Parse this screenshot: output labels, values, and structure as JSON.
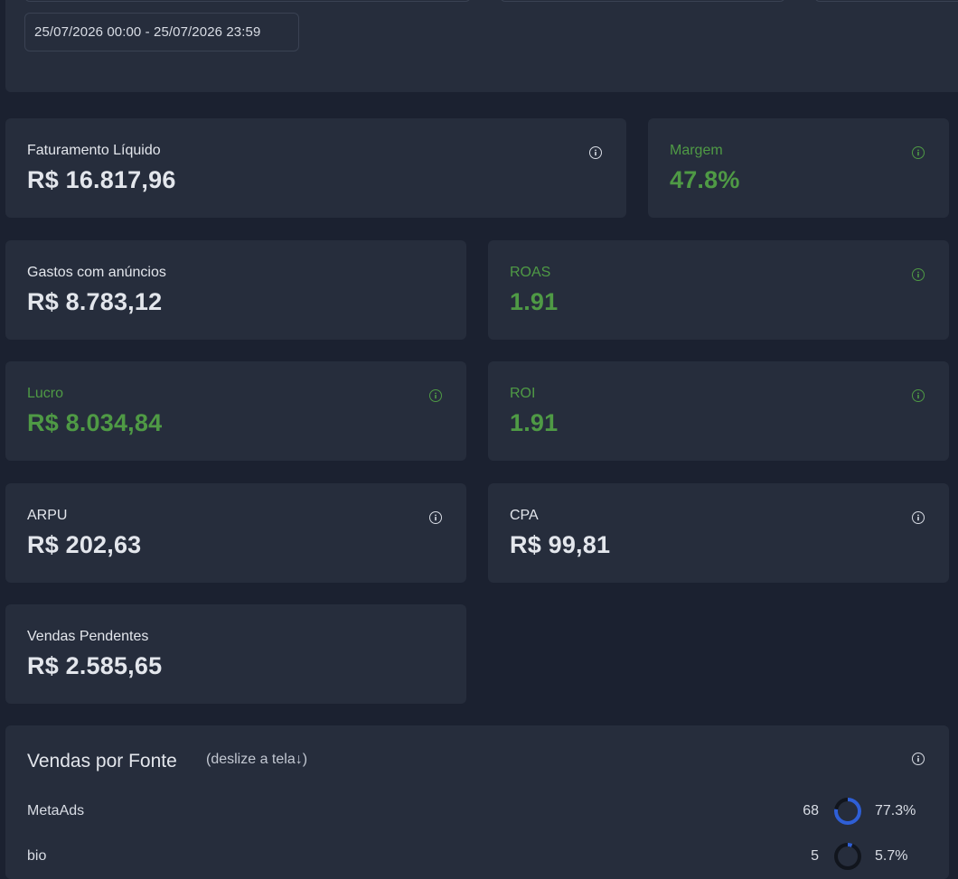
{
  "filter": {
    "date_range": "25/07/2026 00:00 - 25/07/2026 23:59"
  },
  "metrics": {
    "faturamento": {
      "label": "Faturamento Líquido",
      "value": "R$ 16.817,96"
    },
    "margem": {
      "label": "Margem",
      "value": "47.8%"
    },
    "gastos": {
      "label": "Gastos com anúncios",
      "value": "R$ 8.783,12"
    },
    "roas": {
      "label": "ROAS",
      "value": "1.91"
    },
    "lucro": {
      "label": "Lucro",
      "value": "R$ 8.034,84"
    },
    "roi": {
      "label": "ROI",
      "value": "1.91"
    },
    "arpu": {
      "label": "ARPU",
      "value": "R$ 202,63"
    },
    "cpa": {
      "label": "CPA",
      "value": "R$ 99,81"
    },
    "pendentes": {
      "label": "Vendas Pendentes",
      "value": "R$ 2.585,65"
    }
  },
  "vendas_fonte": {
    "title": "Vendas por Fonte",
    "hint": "(deslize a tela↓)",
    "rows": [
      {
        "source": "MetaAds",
        "count": "68",
        "percent": "77.3%",
        "fraction": 0.773
      },
      {
        "source": "bio",
        "count": "5",
        "percent": "5.7%",
        "fraction": 0.057
      }
    ]
  },
  "colors": {
    "positive": "#4f9a45",
    "card": "#262d3c",
    "background": "#1b2130",
    "donut_fill": "#2f5fd6",
    "donut_track": "#11151d"
  },
  "icons": {
    "info": "info-circle-icon"
  }
}
